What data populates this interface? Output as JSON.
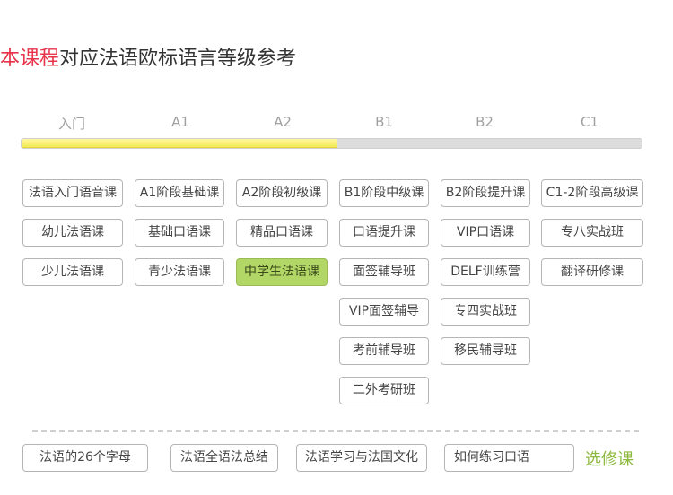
{
  "title": {
    "highlight": "本课程",
    "rest": "对应法语欧标语言等级参考"
  },
  "levels": [
    "入门",
    "A1",
    "A2",
    "B1",
    "B2",
    "C1"
  ],
  "progress": {
    "fraction": 0.51,
    "color": "#f3e94d"
  },
  "columns": [
    [
      "法语入门语音课",
      "幼儿法语课",
      "少儿法语课"
    ],
    [
      "A1阶段基础课",
      "基础口语课",
      "青少法语课"
    ],
    [
      "A2阶段初级课",
      "精品口语课",
      "中学生法语课"
    ],
    [
      "B1阶段中级课",
      "口语提升课",
      "面签辅导班",
      "VIP面签辅导",
      "考前辅导班",
      "二外考研班"
    ],
    [
      "B2阶段提升课",
      "VIP口语课",
      "DELF训练营",
      "专四实战班",
      "移民辅导班"
    ],
    [
      "C1-2阶段高级课",
      "专八实战班",
      "翻译研修课"
    ]
  ],
  "active_course": "中学生法语课",
  "electives": [
    "法语的26个字母",
    "法语全语法总结",
    "法语学习与法国文化",
    "如何练习口语"
  ],
  "elective_label": "选修课",
  "colors": {
    "accent": "#e8334a",
    "active": "#b3d766",
    "elective": "#8cba3f"
  }
}
